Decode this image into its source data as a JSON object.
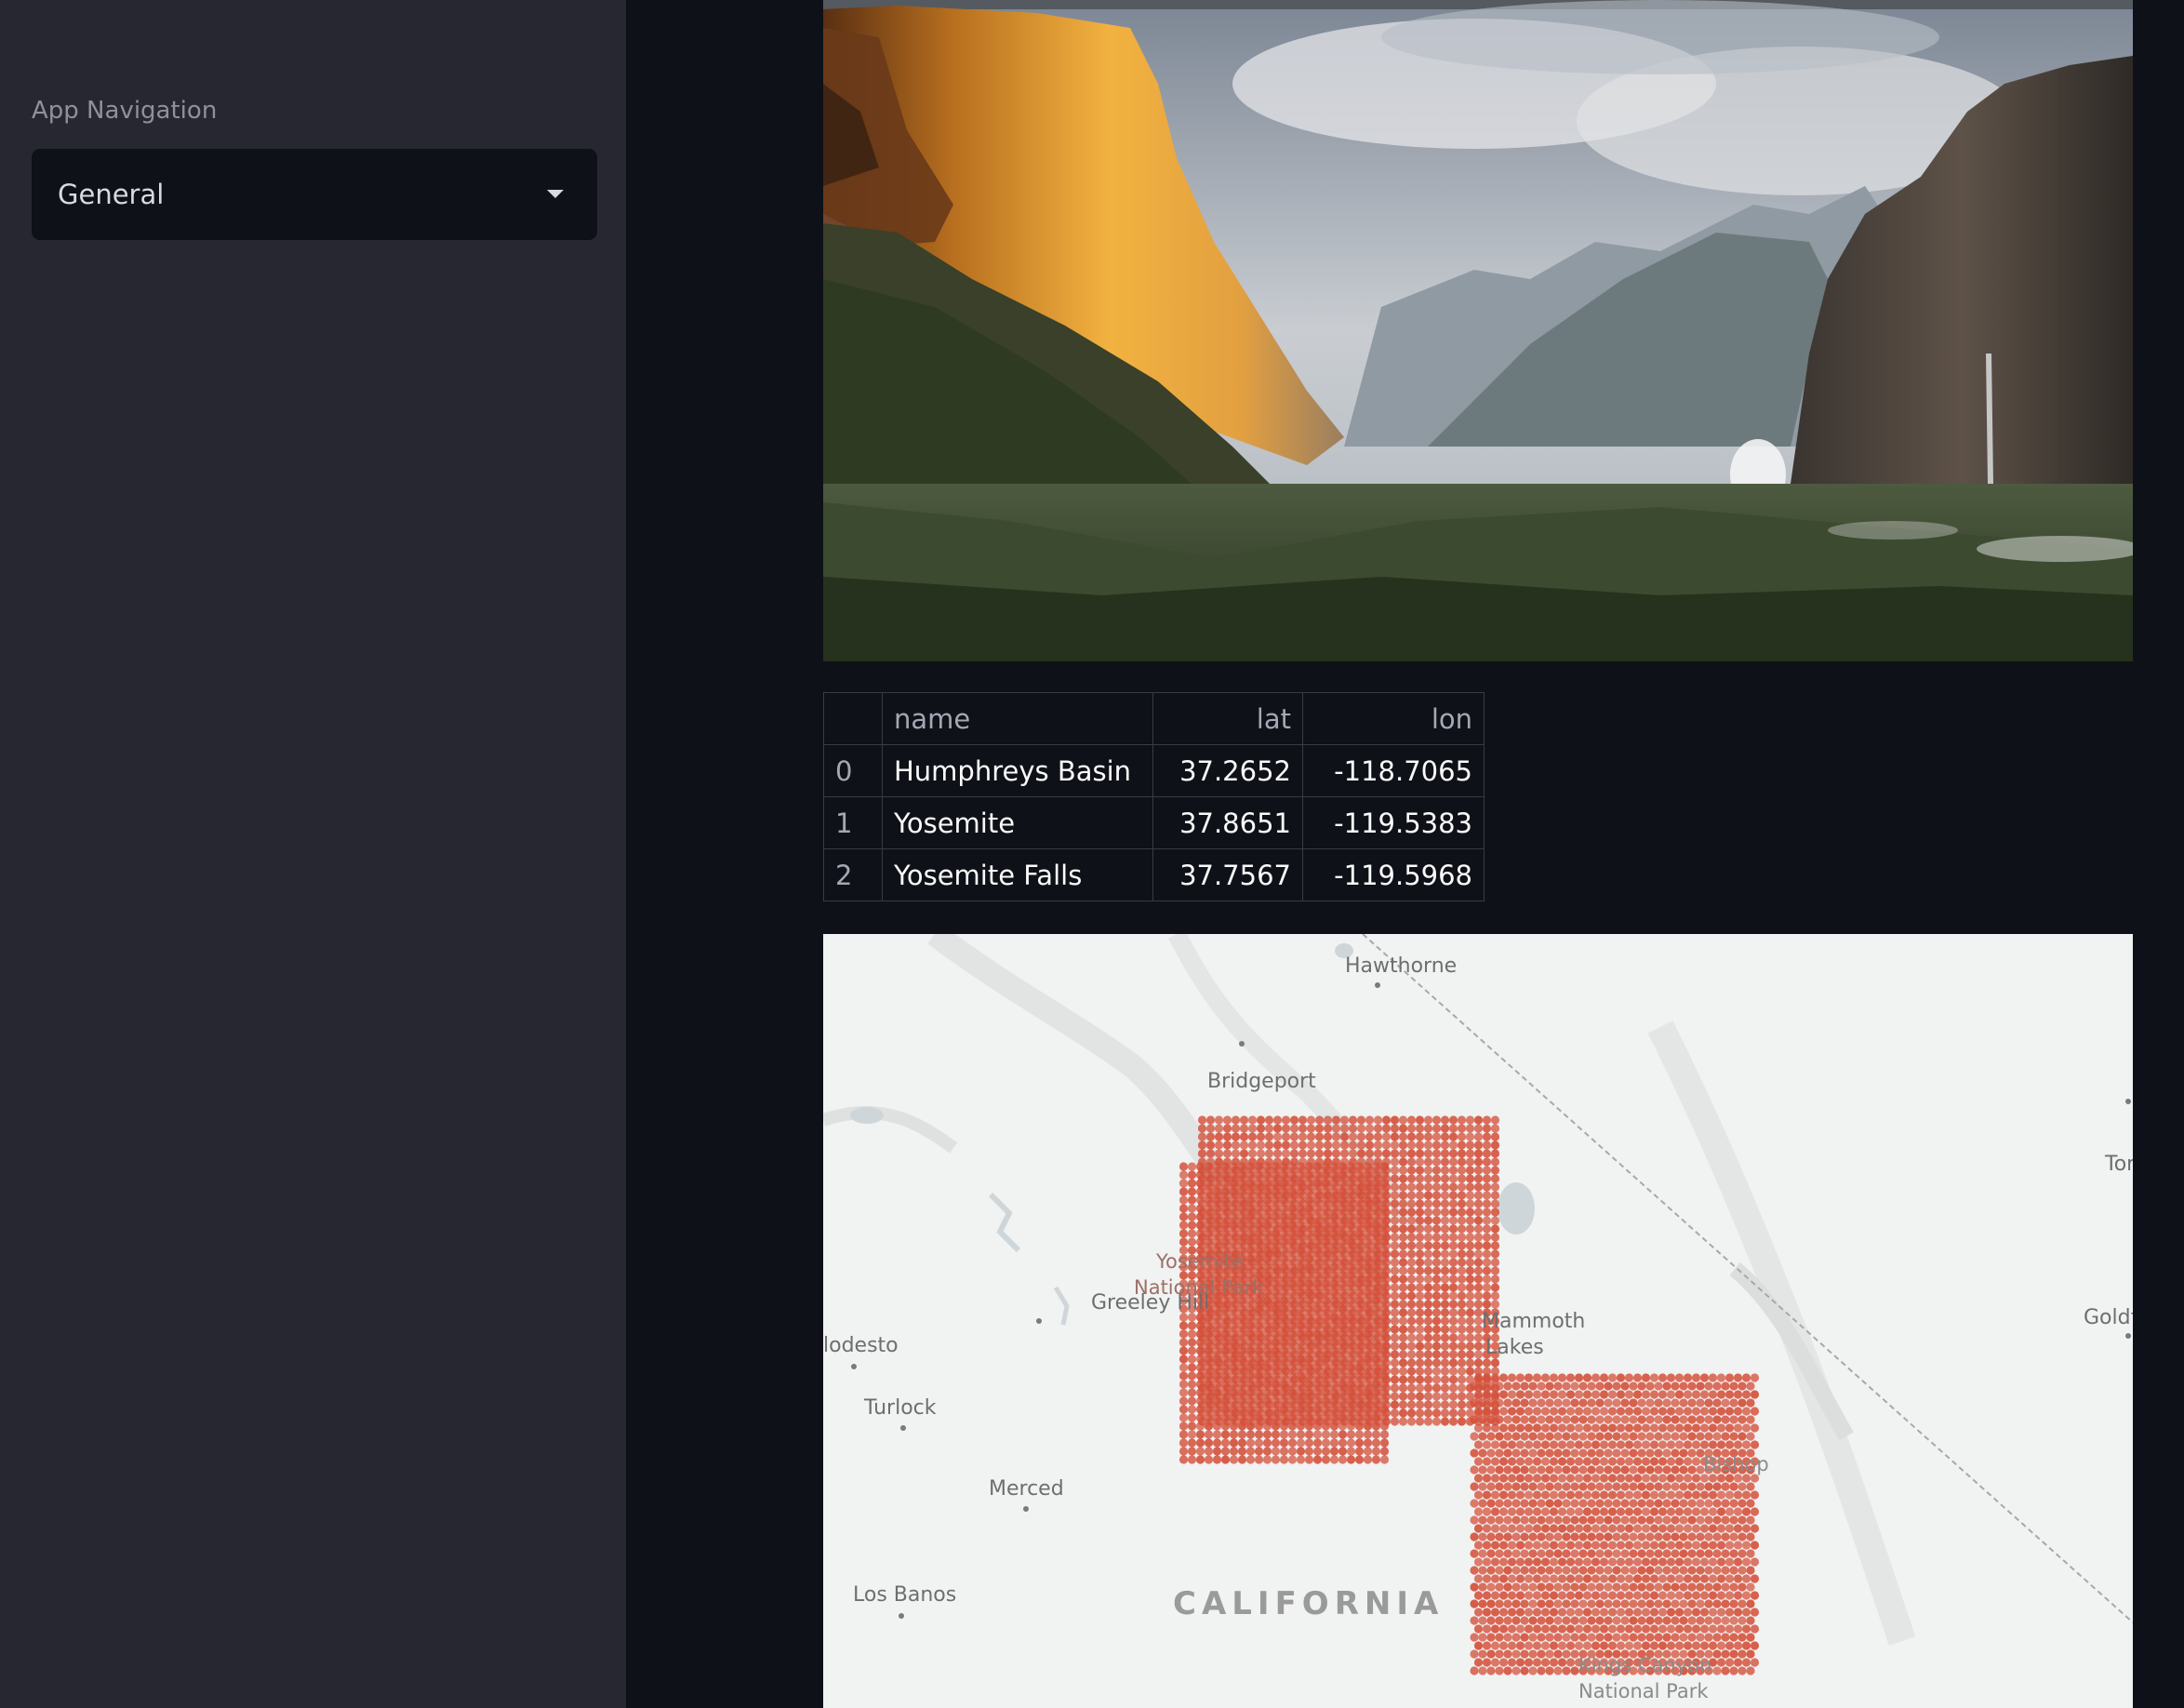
{
  "sidebar": {
    "nav_label": "App Navigation",
    "select": {
      "value": "General"
    }
  },
  "hero": {
    "alt": "Yosemite Valley"
  },
  "table": {
    "columns": [
      "",
      "name",
      "lat",
      "lon"
    ],
    "rows": [
      {
        "index": "0",
        "name": "Humphreys Basin",
        "lat": "37.2652",
        "lon": "-118.7065"
      },
      {
        "index": "1",
        "name": "Yosemite",
        "lat": "37.8651",
        "lon": "-119.5383"
      },
      {
        "index": "2",
        "name": "Yosemite Falls",
        "lat": "37.7567",
        "lon": "-119.5968"
      }
    ]
  },
  "map": {
    "labels": {
      "hawthorne": "Hawthorne",
      "bridgeport": "Bridgeport",
      "tono": "Tono",
      "greeley_hill": "Greeley Hill",
      "yosemite_np_1": "Yosemite",
      "yosemite_np_2": "National Park",
      "mammoth_1": "Mammoth",
      "mammoth_2": "Lakes",
      "goldfield": "Goldf",
      "modesto": "lodesto",
      "turlock": "Turlock",
      "bishop": "Bishop",
      "merced": "Merced",
      "los_banos": "Los Banos",
      "california": "CALIFORNIA",
      "kings_canyon_1": "Kings Canyon",
      "kings_canyon_2": "National Park"
    },
    "hex_color": "#d4503a"
  }
}
